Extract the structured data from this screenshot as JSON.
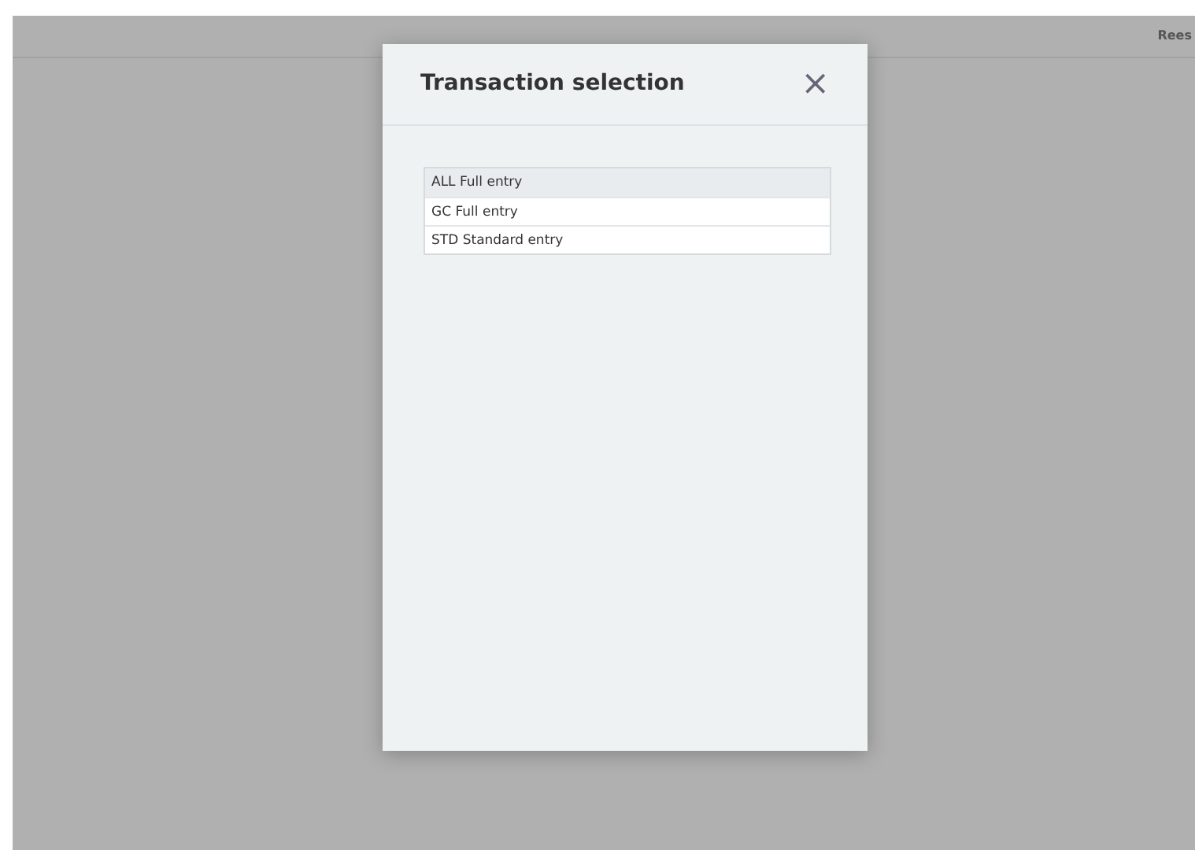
{
  "top_bar": {
    "user": "Rees"
  },
  "dialog": {
    "title": "Transaction selection",
    "close": "×",
    "items": [
      {
        "label": "ALL Full entry",
        "selected": true
      },
      {
        "label": "GC Full entry",
        "selected": false
      },
      {
        "label": "STD Standard entry",
        "selected": false
      }
    ]
  }
}
